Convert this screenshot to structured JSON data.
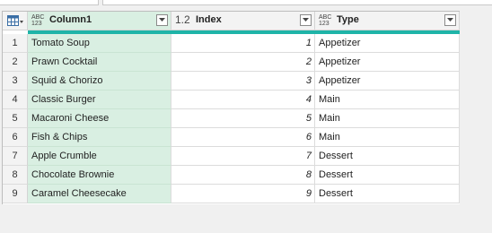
{
  "table_icon": "table-menu-icon",
  "columns": [
    {
      "type_icon_top": "ABC",
      "type_icon_bottom": "123",
      "name": "Column1"
    },
    {
      "type_icon": "1.2",
      "name": "Index"
    },
    {
      "type_icon_top": "ABC",
      "type_icon_bottom": "123",
      "name": "Type"
    }
  ],
  "rows": [
    {
      "n": "1",
      "name": "Tomato Soup",
      "index": "1",
      "type": "Appetizer"
    },
    {
      "n": "2",
      "name": "Prawn Cocktail",
      "index": "2",
      "type": "Appetizer"
    },
    {
      "n": "3",
      "name": "Squid & Chorizo",
      "index": "3",
      "type": "Appetizer"
    },
    {
      "n": "4",
      "name": "Classic Burger",
      "index": "4",
      "type": "Main"
    },
    {
      "n": "5",
      "name": "Macaroni Cheese",
      "index": "5",
      "type": "Main"
    },
    {
      "n": "6",
      "name": "Fish & Chips",
      "index": "6",
      "type": "Main"
    },
    {
      "n": "7",
      "name": "Apple Crumble",
      "index": "7",
      "type": "Dessert"
    },
    {
      "n": "8",
      "name": "Chocolate Brownie",
      "index": "8",
      "type": "Dessert"
    },
    {
      "n": "9",
      "name": "Caramel Cheesecake",
      "index": "9",
      "type": "Dessert"
    }
  ],
  "colors": {
    "selected_column": "#d9efe2",
    "header_bar": "#1fb4a8"
  }
}
